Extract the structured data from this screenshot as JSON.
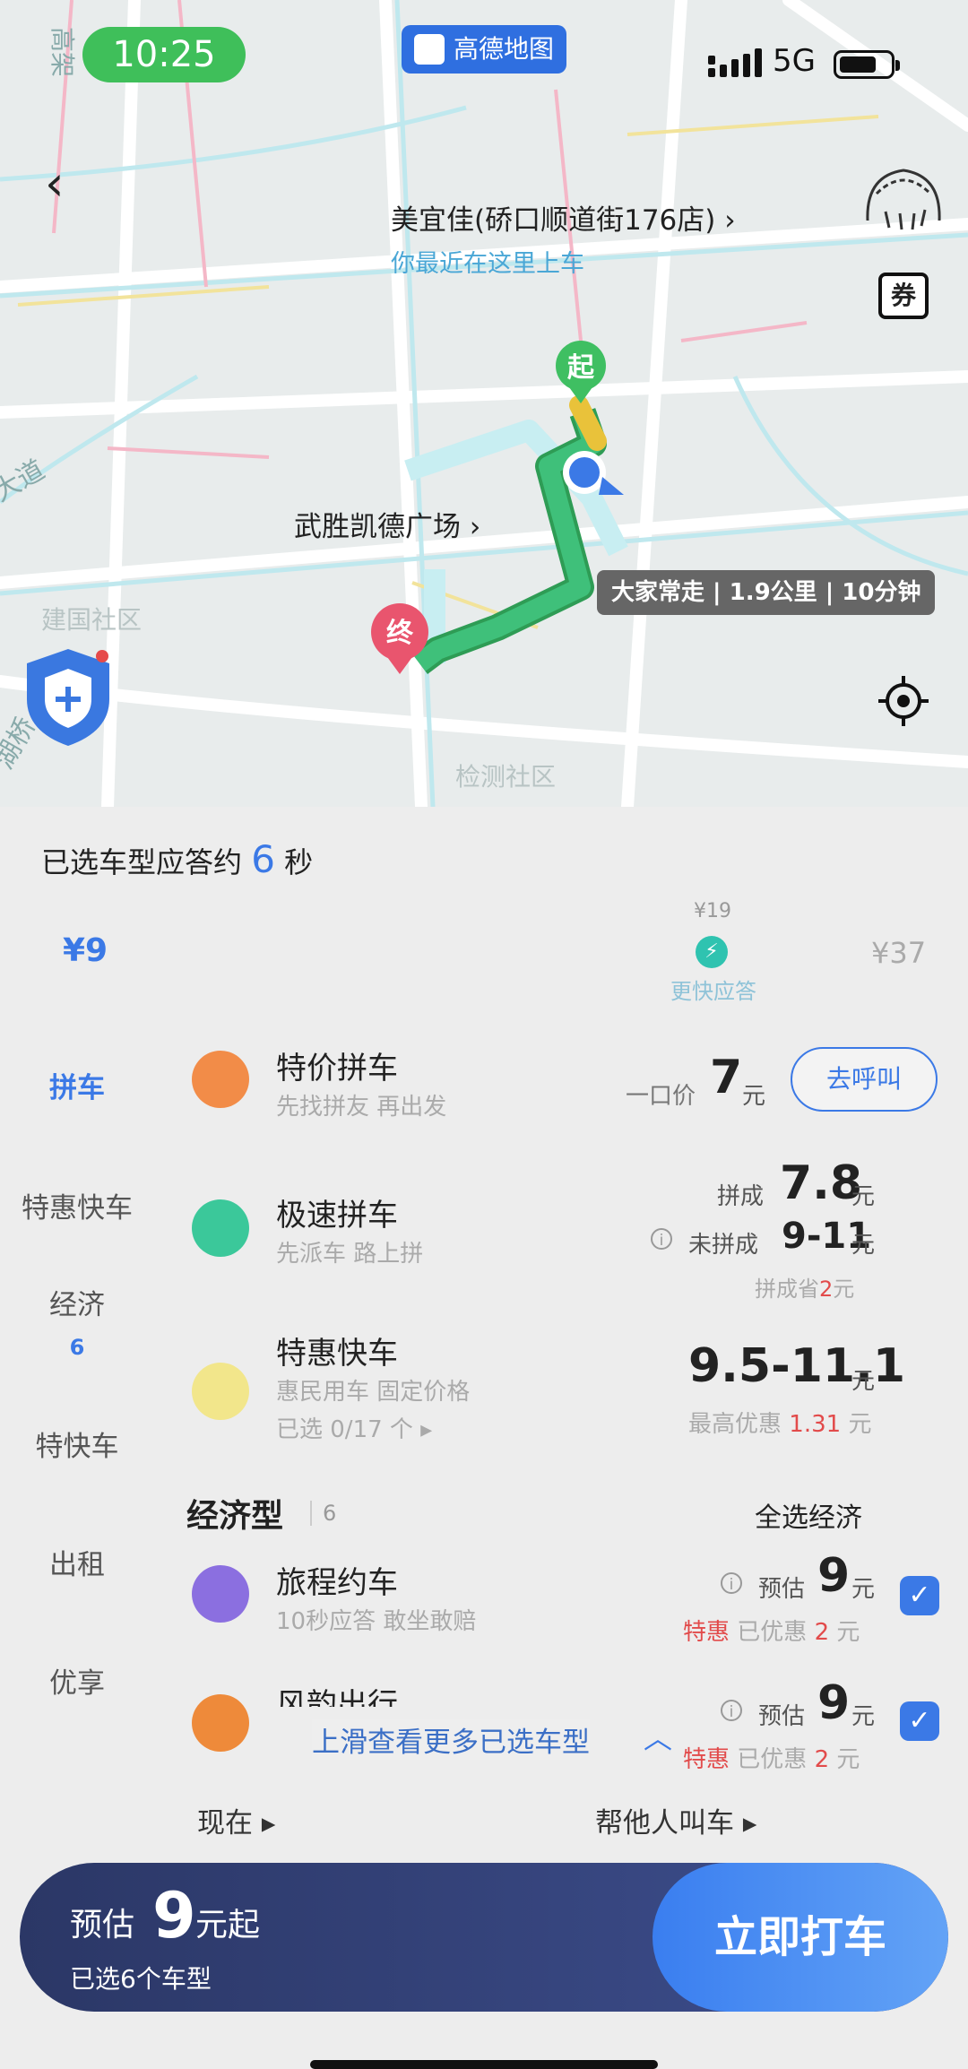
{
  "status_bar": {
    "time": "10:25",
    "app_badge": "高德地图",
    "network": "5G"
  },
  "map": {
    "pickup_title": "美宜佳(硚口顺道街176店) ›",
    "pickup_subtitle": "你最近在这里上车",
    "coupon_label": "券",
    "poi_label": "武胜凯德广场 ›",
    "route_info": "大家常走 | 1.9公里 | 10分钟",
    "start_marker": "起",
    "end_marker": "终",
    "faded_label_1": "建国社区",
    "faded_label_2": "检测社区",
    "road_label_1": "高架",
    "road_label_2": "大道",
    "road_label_3": "湖桥"
  },
  "colors": {
    "accent": "#3b79e6",
    "route": "#3fb86a",
    "order_button": "#4a8ff2",
    "bottom_bar": "#2b3766"
  },
  "response": {
    "prefix": "已选车型应答约",
    "seconds": "6",
    "suffix": "秒"
  },
  "price_scale": {
    "min": "¥9",
    "mid": "¥19",
    "mid_label": "更快应答",
    "max": "¥37"
  },
  "categories": [
    {
      "label": "拼车",
      "active": true
    },
    {
      "label": "特惠快车"
    },
    {
      "label": "经济",
      "count": "6"
    },
    {
      "label": "特快车"
    },
    {
      "label": "出租"
    },
    {
      "label": "优享"
    }
  ],
  "options": {
    "tejia": {
      "name": "特价拼车",
      "desc": "先找拼友 再出发",
      "prefix": "一口价",
      "price": "7",
      "unit": "元",
      "button": "去呼叫"
    },
    "jisu": {
      "name": "极速拼车",
      "desc": "先派车 路上拼",
      "p1_label": "拼成",
      "p1": "7.8",
      "unit": "元",
      "p2_label": "未拼成",
      "p2": "9-11",
      "save_prefix": "拼成省",
      "save": "2",
      "save_unit": "元"
    },
    "tehui": {
      "name": "特惠快车",
      "desc": "惠民用车 固定价格",
      "selected": "已选 0/17 个 ▸",
      "price": "9.5-11.1",
      "unit": "元",
      "discount_prefix": "最高优惠",
      "discount": "1.31",
      "discount_unit": "元"
    }
  },
  "group": {
    "title": "经济型",
    "count": "6",
    "select_all": "全选经济"
  },
  "econ_options": [
    {
      "name": "旅程约车",
      "desc": "10秒应答 敢坐敢赔",
      "prefix": "预估",
      "price": "9",
      "unit": "元",
      "tag": "特惠",
      "discount_prefix": "已优惠",
      "discount": "2",
      "discount_unit": "元"
    },
    {
      "name": "风韵出行",
      "prefix": "预估",
      "price": "9",
      "unit": "元",
      "tag": "特惠",
      "discount_prefix": "已优惠",
      "discount": "2",
      "discount_unit": "元"
    }
  ],
  "hint": "上滑查看更多已选车型",
  "footer_links": {
    "now": "现在 ▸",
    "for_others": "帮他人叫车 ▸"
  },
  "bottom_bar": {
    "label": "预估",
    "price": "9",
    "suffix": "元起",
    "selected": "已选6个车型",
    "button": "立即打车"
  }
}
